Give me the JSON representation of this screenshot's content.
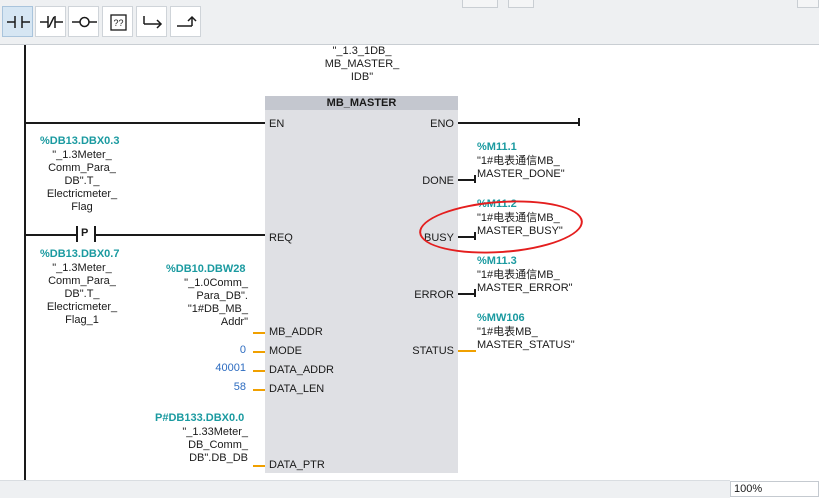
{
  "toolbar": {
    "buttons": [
      {
        "icon": "normally-open-contact-icon",
        "active": true
      },
      {
        "icon": "normally-closed-contact-icon",
        "active": false
      },
      {
        "icon": "coil-icon",
        "active": false
      },
      {
        "icon": "empty-box-icon",
        "active": false
      },
      {
        "icon": "open-branch-icon",
        "active": false
      },
      {
        "icon": "close-branch-icon",
        "active": false
      }
    ]
  },
  "block": {
    "instance_db": "\"_1.3_1DB_\nMB_MASTER_\nIDB\"",
    "title": "MB_MASTER",
    "inputs": {
      "en": "EN",
      "req": "REQ",
      "mb_addr": "MB_ADDR",
      "mode": "MODE",
      "data_addr": "DATA_ADDR",
      "data_len": "DATA_LEN",
      "data_ptr": "DATA_PTR"
    },
    "outputs": {
      "eno": "ENO",
      "done": "DONE",
      "busy": "BUSY",
      "error": "ERROR",
      "status": "STATUS"
    }
  },
  "contacts": {
    "contact1": {
      "address": "%DB13.DBX0.3",
      "symbol": "\"_1.3Meter_\nComm_Para_\nDB\".T_\nElectricmeter_\nFlag"
    },
    "contact2": {
      "type_label": "P",
      "address": "%DB13.DBX0.7",
      "symbol": "\"_1.3Meter_\nComm_Para_\nDB\".T_\nElectricmeter_\nFlag_1"
    }
  },
  "params": {
    "mb_addr": {
      "address": "%DB10.DBW28",
      "symbol": "\"_1.0Comm_\nPara_DB\".\n\"1#DB_MB_\nAddr\""
    },
    "mode": "0",
    "data_addr": "40001",
    "data_len": "58",
    "data_ptr": {
      "address": "P#DB133.DBX0.0",
      "symbol": "\"_1.33Meter_\nDB_Comm_\nDB\".DB_DB"
    }
  },
  "out_tags": {
    "done": {
      "address": "%M11.1",
      "symbol": "\"1#电表通信MB_\nMASTER_DONE\""
    },
    "busy": {
      "address": "%M11.2",
      "symbol": "\"1#电表通信MB_\nMASTER_BUSY\""
    },
    "error": {
      "address": "%M11.3",
      "symbol": "\"1#电表通信MB_\nMASTER_ERROR\""
    },
    "status": {
      "address": "%MW106",
      "symbol": "\"1#电表MB_\nMASTER_STATUS\""
    }
  },
  "statusbar": {
    "zoom": "100%"
  },
  "colors": {
    "address": "#1a9aa0",
    "constant": "#2d6cc0",
    "param_wire": "#f0a000",
    "annotation": "#e41e1e"
  }
}
